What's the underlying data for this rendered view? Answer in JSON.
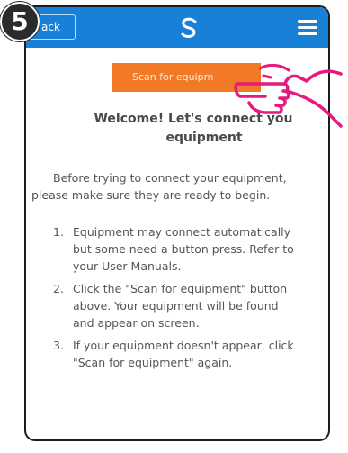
{
  "header": {
    "back_label": "ack",
    "logo_icon": "swirl-logo-icon",
    "menu_icon": "hamburger-menu-icon",
    "background_color": "#1880d6"
  },
  "scan_button": {
    "label": "Scan for equipm",
    "color": "#f27a26"
  },
  "welcome": {
    "line1": "Welcome! Let's connect you",
    "line2": "equipment"
  },
  "intro": {
    "line1": "Before trying to connect your equipment,",
    "line2": "please make sure they are ready to begin."
  },
  "steps": [
    {
      "number": "1.",
      "lines": [
        "Equipment may connect automatically",
        "but some need a button press. Refer to",
        "your User Manuals."
      ]
    },
    {
      "number": "2.",
      "lines": [
        "Click the \"Scan for equipment\" button",
        "above. Your equipment will be found",
        "and appear on screen."
      ]
    },
    {
      "number": "3.",
      "lines": [
        "If your equipment doesn't appear, click",
        "\"Scan for equipment\" again."
      ]
    }
  ],
  "annotation": {
    "step_number": "5",
    "pointer_icon": "pointing-hand-icon",
    "pointer_color": "#e5197e"
  }
}
